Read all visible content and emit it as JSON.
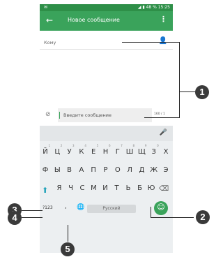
{
  "status_bar": {
    "left_icon": "message-notification-icon",
    "right_text": "◢ ▮ 48 % 15:25"
  },
  "app_bar": {
    "back_icon": "arrow-back-icon",
    "title": "Новое сообщение",
    "menu_icon": "more-vert-icon"
  },
  "recipient": {
    "label": "Кому",
    "add_icon": "person-add-icon"
  },
  "compose": {
    "attach_icon": "paperclip-icon",
    "placeholder": "Введите сообщение",
    "counter": "160 / 1"
  },
  "keyboard": {
    "mic_icon": "mic-icon",
    "row1": [
      {
        "k": "Й",
        "n": "1"
      },
      {
        "k": "Ц",
        "n": "2"
      },
      {
        "k": "У",
        "n": "3"
      },
      {
        "k": "К",
        "n": "4"
      },
      {
        "k": "Е",
        "n": "5"
      },
      {
        "k": "Н",
        "n": "6"
      },
      {
        "k": "Г",
        "n": "7"
      },
      {
        "k": "Ш",
        "n": "8"
      },
      {
        "k": "Щ",
        "n": "9"
      },
      {
        "k": "З",
        "n": "0"
      },
      {
        "k": "Х",
        "n": ""
      }
    ],
    "row2": [
      "Ф",
      "Ы",
      "В",
      "А",
      "П",
      "Р",
      "О",
      "Л",
      "Д",
      "Ж",
      "Э"
    ],
    "row3": [
      "Я",
      "Ч",
      "С",
      "М",
      "И",
      "Т",
      "Ь",
      "Б",
      "Ю"
    ],
    "shift_icon": "shift-arrow-icon",
    "backspace_icon": "backspace-icon",
    "num_label": "?123",
    "comma": ",",
    "globe_icon": "globe-icon",
    "space_label": "Русский",
    "emoji_icon": "emoji-smile-icon"
  },
  "callouts": [
    "1",
    "2",
    "3",
    "4",
    "5"
  ]
}
